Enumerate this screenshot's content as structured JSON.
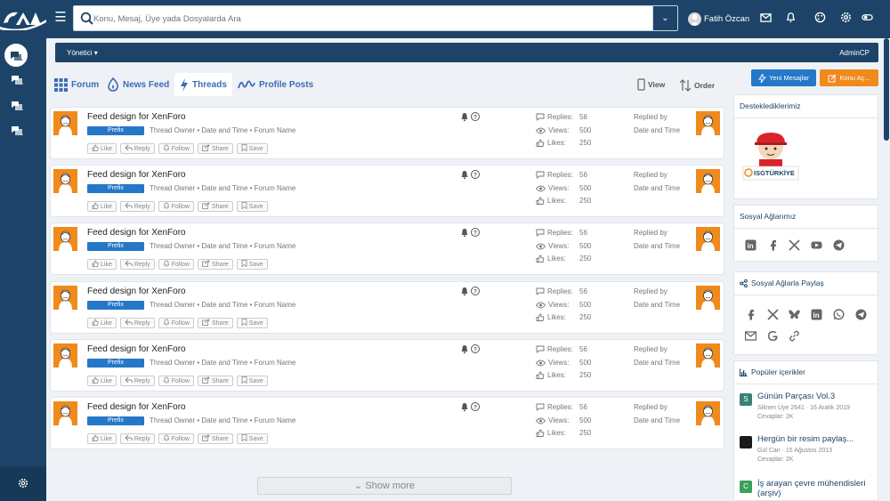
{
  "header": {
    "search_placeholder": "Konu, Mesaj, Üye yada Dosyalarda Ara",
    "user_name": "Fatih Özcan"
  },
  "admin_bar": {
    "left": "Yönetici",
    "right": "AdminCP"
  },
  "tabs": [
    {
      "label": "Forum"
    },
    {
      "label": "News Feed"
    },
    {
      "label": "Threads"
    },
    {
      "label": "Profile Posts"
    }
  ],
  "toolbar": {
    "view": "View",
    "order": "Order"
  },
  "buttons": {
    "new_messages": "Yeni Mesajlar",
    "new_thread": "Konu Aç..."
  },
  "thread_common": {
    "title": "Feed design for XenForo",
    "prefix": "Prefix",
    "meta": "Thread Owner • Date and Time • Forum Name",
    "actions": [
      "Like",
      "Reply",
      "Follow",
      "Share",
      "Save"
    ],
    "replies_label": "Replies:",
    "replies_value": "56",
    "views_label": "Views:",
    "views_value": "500",
    "likes_label": "Likes:",
    "likes_value": "250",
    "replied_by": "Replied by",
    "replied_date": "Date and Time"
  },
  "show_more": "Show more",
  "widgets": {
    "supporters": {
      "title": "Desteklediklerimiz"
    },
    "social": {
      "title": "Sosyal Ağlarımız"
    },
    "share": {
      "title": "Sosyal Ağlarla Paylaş"
    },
    "popular": {
      "title": "Popüler içerikler",
      "items": [
        {
          "title": "Günün Parçası Vol.3",
          "sub": "Silinen Üye 2641 · 16 Aralık 2019",
          "sub2": "Cevaplar: 2K",
          "avatar": "S",
          "color": "#3b7f7a"
        },
        {
          "title": "Hergün bir resim paylaş...",
          "sub": "Gül Can · 15 Ağustos 2013",
          "sub2": "Cevaplar: 2K",
          "avatar": "",
          "color": "#1a1a1a"
        },
        {
          "title": "İş arayan çevre mühendisleri (arşiv)",
          "sub": "",
          "sub2": "",
          "avatar": "C",
          "color": "#3aa05a"
        }
      ]
    }
  },
  "colors": {
    "primary": "#1d4468",
    "accent_blue": "#2577c8",
    "accent_orange": "#f08a1c"
  }
}
